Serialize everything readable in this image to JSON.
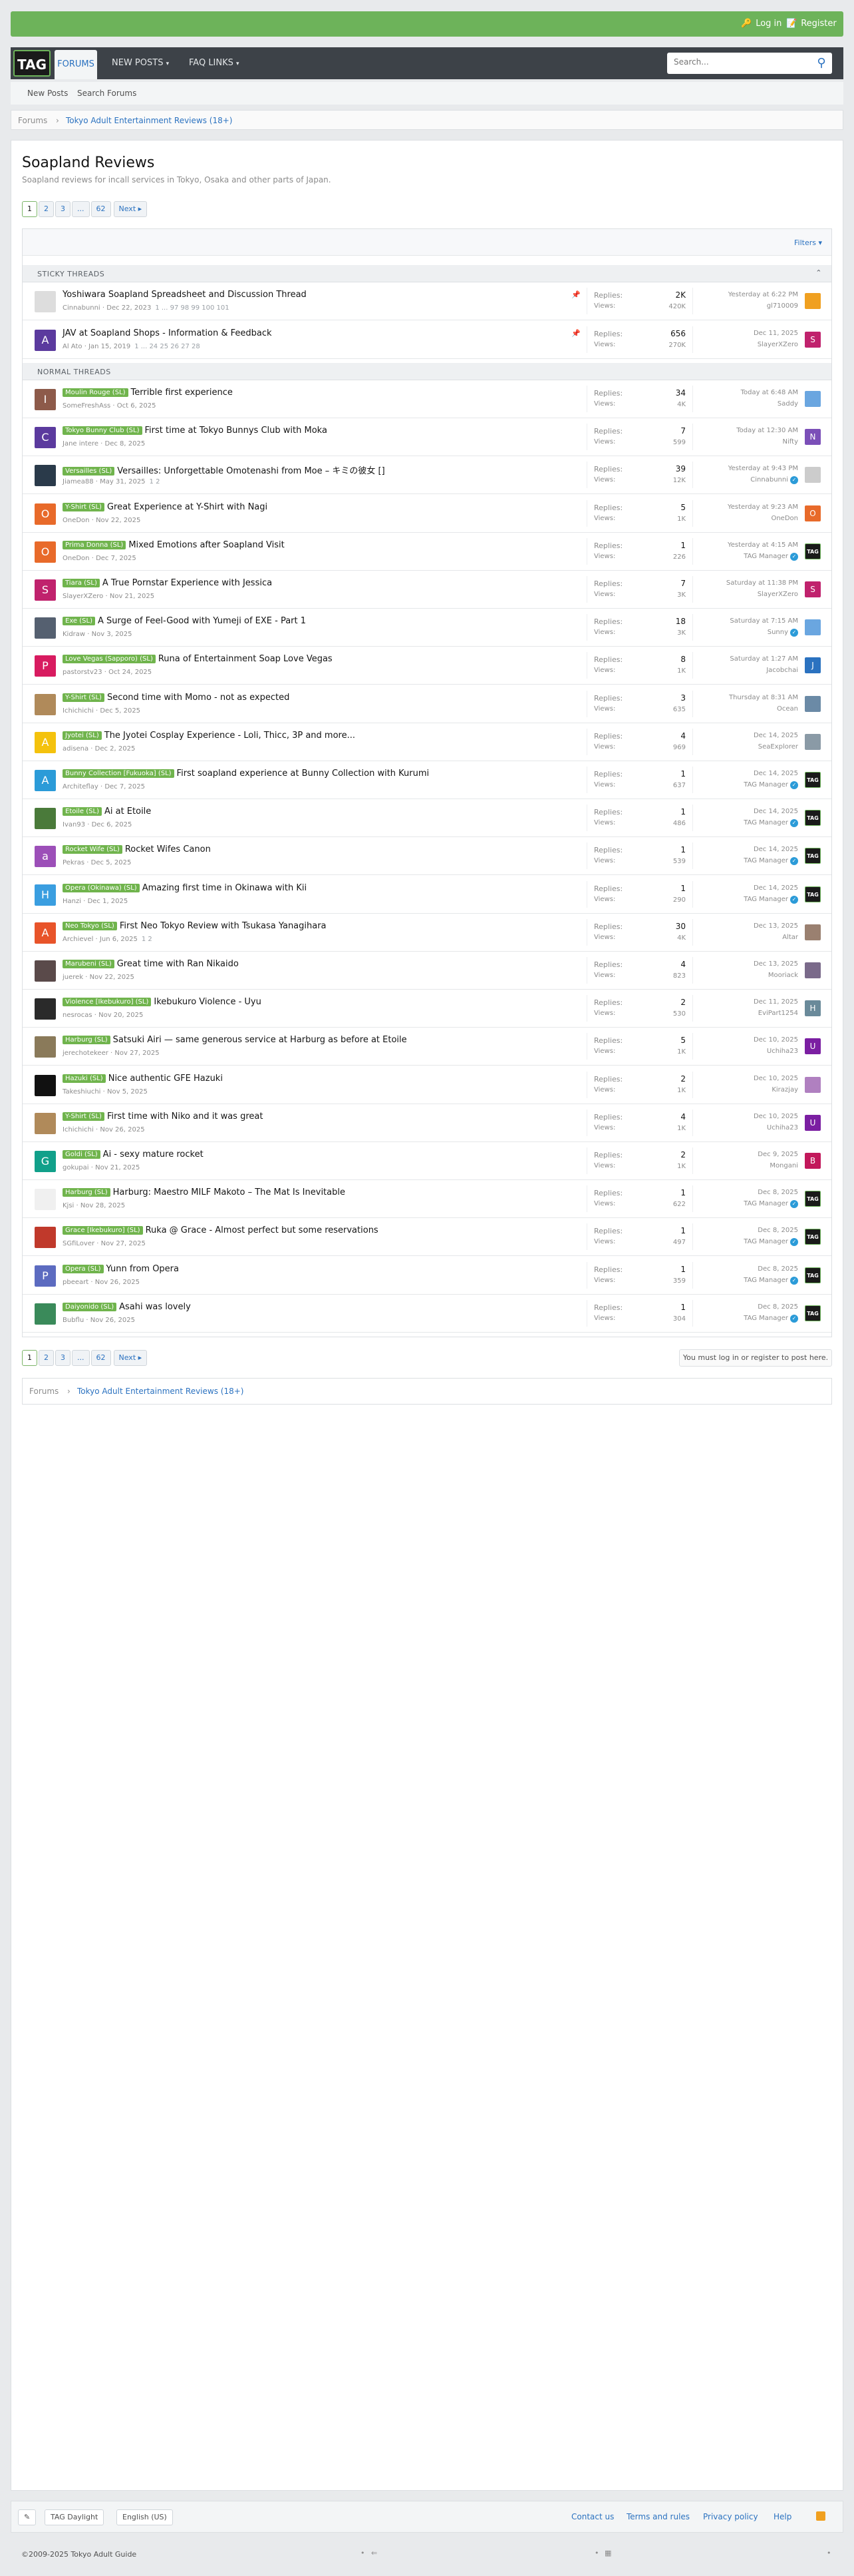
{
  "header": {
    "login_label": "Log in",
    "register_label": "Register",
    "logo_text": "TAG",
    "nav": [
      "FORUMS",
      "NEW POSTS",
      "FAQ LINKS"
    ],
    "search_placeholder": "Search...",
    "subnav": [
      "New Posts",
      "Search Forums"
    ],
    "breadcrumb": [
      "Forums",
      "Tokyo Adult Entertainment Reviews (18+)"
    ]
  },
  "forum": {
    "title": "Soapland Reviews",
    "description": "Soapland reviews for incall services in Tokyo, Osaka and other parts of Japan.",
    "pages": [
      "1",
      "2",
      "3",
      "...",
      "62",
      "Next ▸"
    ],
    "filters_label": "Filters ▾",
    "sticky_label": "STICKY THREADS",
    "normal_label": "NORMAL THREADS",
    "login_note": "You must log in or register to post here."
  },
  "sticky": [
    {
      "prefix": "",
      "title": "Yoshiwara Soapland Spreadsheet and Discussion Thread",
      "author": "Cinnabunni",
      "date": "Dec 22, 2023",
      "pages": "1 ... 97 98 99 100 101",
      "replies": "2K",
      "views": "420K",
      "last_date": "Yesterday at 6:22 PM",
      "last_user": "gl710009",
      "av": "",
      "av_color": "#dddddd",
      "sav": "",
      "sav_color": "#f0a020"
    },
    {
      "prefix": "",
      "title": "JAV at Soapland Shops - Information & Feedback",
      "author": "Al Ato",
      "date": "Jan 15, 2019",
      "pages": "1 ... 24 25 26 27 28",
      "replies": "656",
      "views": "270K",
      "last_date": "Dec 11, 2025",
      "last_user": "SlayerXZero",
      "av": "A",
      "av_color": "#5b3a9e",
      "sav": "S",
      "sav_color": "#c0226d"
    }
  ],
  "threads": [
    {
      "prefix": "Moulin Rouge (SL)",
      "title": "Terrible first experience",
      "author": "SomeFreshAss",
      "date": "Oct 6, 2025",
      "pages": "",
      "replies": "34",
      "views": "4K",
      "last_date": "Today at 6:48 AM",
      "last_user": "Saddy",
      "av": "I",
      "av_color": "#8d5a4a",
      "sav": "",
      "sav_color": "#6aa6e0"
    },
    {
      "prefix": "Tokyo Bunny Club (SL)",
      "title": "First time at Tokyo Bunnys Club with Moka",
      "author": "Jane intere",
      "date": "Dec 8, 2025",
      "pages": "",
      "replies": "7",
      "views": "599",
      "last_date": "Today at 12:30 AM",
      "last_user": "Nifty",
      "av": "C",
      "av_color": "#5b3a9e",
      "sav": "N",
      "sav_color": "#7b4fb8"
    },
    {
      "prefix": "Versailles (SL)",
      "title": "Versailles: Unforgettable Omotenashi from Moe – キミの彼女 []",
      "author": "Jiamea88",
      "date": "May 31, 2025",
      "pages": "1 2",
      "replies": "39",
      "views": "12K",
      "last_date": "Yesterday at 9:43 PM",
      "last_user": "Cinnabunni",
      "av": "",
      "av_color": "#2a3a4a",
      "sav": "",
      "sav_color": "#cccccc"
    },
    {
      "prefix": "Y-Shirt (SL)",
      "title": "Great Experience at Y-Shirt with Nagi",
      "author": "OneDon",
      "date": "Nov 22, 2025",
      "pages": "",
      "replies": "5",
      "views": "1K",
      "last_date": "Yesterday at 9:23 AM",
      "last_user": "OneDon",
      "av": "O",
      "av_color": "#e86a2a",
      "sav": "O",
      "sav_color": "#e86a2a"
    },
    {
      "prefix": "Prima Donna (SL)",
      "title": "Mixed Emotions after Soapland Visit",
      "author": "OneDon",
      "date": "Dec 7, 2025",
      "pages": "",
      "replies": "1",
      "views": "226",
      "last_date": "Yesterday at 4:15 AM",
      "last_user": "TAG Manager",
      "av": "O",
      "av_color": "#e86a2a",
      "sav": "TAG",
      "sav_color": "#1a1a1a"
    },
    {
      "prefix": "Tiara (SL)",
      "title": "A True Pornstar Experience with Jessica",
      "author": "SlayerXZero",
      "date": "Nov 21, 2025",
      "pages": "",
      "replies": "7",
      "views": "3K",
      "last_date": "Saturday at 11:38 PM",
      "last_user": "SlayerXZero",
      "av": "S",
      "av_color": "#c0226d",
      "sav": "S",
      "sav_color": "#c0226d"
    },
    {
      "prefix": "Exe (SL)",
      "title": "A Surge of Feel-Good with Yumeji of EXE - Part 1",
      "author": "Kidraw",
      "date": "Nov 3, 2025",
      "pages": "",
      "replies": "18",
      "views": "3K",
      "last_date": "Saturday at 7:15 AM",
      "last_user": "Sunny",
      "av": "",
      "av_color": "#556070",
      "sav": "",
      "sav_color": "#6aa6e0"
    },
    {
      "prefix": "Love Vegas (Sapporo) (SL)",
      "title": "Runa of Entertainment Soap Love Vegas",
      "author": "pastorstv23",
      "date": "Oct 24, 2025",
      "pages": "",
      "replies": "8",
      "views": "1K",
      "last_date": "Saturday at 1:27 AM",
      "last_user": "Jacobchai",
      "av": "P",
      "av_color": "#d81b60",
      "sav": "J",
      "sav_color": "#2b72c0"
    },
    {
      "prefix": "Y-Shirt (SL)",
      "title": "Second time with Momo - not as expected",
      "author": "Ichichichi",
      "date": "Dec 5, 2025",
      "pages": "",
      "replies": "3",
      "views": "635",
      "last_date": "Thursday at 8:31 AM",
      "last_user": "Ocean",
      "av": "",
      "av_color": "#b08a5a",
      "sav": "",
      "sav_color": "#6b8aa6"
    },
    {
      "prefix": "Jyotei (SL)",
      "title": "The Jyotei Cosplay Experience - Loli, Thicc, 3P and more...",
      "author": "adisena",
      "date": "Dec 2, 2025",
      "pages": "",
      "replies": "4",
      "views": "969",
      "last_date": "Dec 14, 2025",
      "last_user": "SeaExplorer",
      "av": "A",
      "av_color": "#f4c20d",
      "sav": "",
      "sav_color": "#8a9aa6"
    },
    {
      "prefix": "Bunny Collection [Fukuoka] (SL)",
      "title": "First soapland experience at Bunny Collection with Kurumi",
      "author": "Architeflay",
      "date": "Dec 7, 2025",
      "pages": "",
      "replies": "1",
      "views": "637",
      "last_date": "Dec 14, 2025",
      "last_user": "TAG Manager",
      "av": "A",
      "av_color": "#2b9bd8",
      "sav": "TAG",
      "sav_color": "#1a1a1a"
    },
    {
      "prefix": "Etoile (SL)",
      "title": "Ai at Etoile",
      "author": "Ivan93",
      "date": "Dec 6, 2025",
      "pages": "",
      "replies": "1",
      "views": "486",
      "last_date": "Dec 14, 2025",
      "last_user": "TAG Manager",
      "av": "",
      "av_color": "#4a7a3a",
      "sav": "TAG",
      "sav_color": "#1a1a1a"
    },
    {
      "prefix": "Rocket Wife (SL)",
      "title": "Rocket Wifes Canon",
      "author": "Pekras",
      "date": "Dec 5, 2025",
      "pages": "",
      "replies": "1",
      "views": "539",
      "last_date": "Dec 14, 2025",
      "last_user": "TAG Manager",
      "av": "a",
      "av_color": "#9c4fb8",
      "sav": "TAG",
      "sav_color": "#1a1a1a"
    },
    {
      "prefix": "Opera (Okinawa) (SL)",
      "title": "Amazing first time in Okinawa with Kii",
      "author": "Hanzi",
      "date": "Dec 1, 2025",
      "pages": "",
      "replies": "1",
      "views": "290",
      "last_date": "Dec 14, 2025",
      "last_user": "TAG Manager",
      "av": "H",
      "av_color": "#3a9ee0",
      "sav": "TAG",
      "sav_color": "#1a1a1a"
    },
    {
      "prefix": "Neo Tokyo (SL)",
      "title": "First Neo Tokyo Review with Tsukasa Yanagihara",
      "author": "Archievel",
      "date": "Jun 6, 2025",
      "pages": "1 2",
      "replies": "30",
      "views": "4K",
      "last_date": "Dec 13, 2025",
      "last_user": "Altar",
      "av": "A",
      "av_color": "#e8542a",
      "sav": "",
      "sav_color": "#9a8070"
    },
    {
      "prefix": "Marubeni (SL)",
      "title": "Great time with Ran Nikaido",
      "author": "juerek",
      "date": "Nov 22, 2025",
      "pages": "",
      "replies": "4",
      "views": "823",
      "last_date": "Dec 13, 2025",
      "last_user": "Mooriack",
      "av": "",
      "av_color": "#5a4a4a",
      "sav": "",
      "sav_color": "#7a6a8a"
    },
    {
      "prefix": "Violence [Ikebukuro] (SL)",
      "title": "Ikebukuro Violence - Uyu",
      "author": "nesrocas",
      "date": "Nov 20, 2025",
      "pages": "",
      "replies": "2",
      "views": "530",
      "last_date": "Dec 11, 2025",
      "last_user": "EviPart1254",
      "av": "",
      "av_color": "#2a2a2a",
      "sav": "H",
      "sav_color": "#6a8a9a"
    },
    {
      "prefix": "Harburg (SL)",
      "title": "Satsuki Airi — same generous service at Harburg as before at Etoile",
      "author": "jerechotekeer",
      "date": "Nov 27, 2025",
      "pages": "",
      "replies": "5",
      "views": "1K",
      "last_date": "Dec 10, 2025",
      "last_user": "Uchiha23",
      "av": "",
      "av_color": "#8a7a5a",
      "sav": "U",
      "sav_color": "#7b1fa2"
    },
    {
      "prefix": "Hazuki (SL)",
      "title": "Nice authentic GFE Hazuki",
      "author": "Takeshiuchi",
      "date": "Nov 5, 2025",
      "pages": "",
      "replies": "2",
      "views": "1K",
      "last_date": "Dec 10, 2025",
      "last_user": "Kirazjay",
      "av": "",
      "av_color": "#111111",
      "sav": "",
      "sav_color": "#b080c0"
    },
    {
      "prefix": "Y-Shirt (SL)",
      "title": "First time with Niko and it was great",
      "author": "Ichichichi",
      "date": "Nov 26, 2025",
      "pages": "",
      "replies": "4",
      "views": "1K",
      "last_date": "Dec 10, 2025",
      "last_user": "Uchiha23",
      "av": "",
      "av_color": "#b08a5a",
      "sav": "U",
      "sav_color": "#7b1fa2"
    },
    {
      "prefix": "Goldi (SL)",
      "title": "Ai - sexy mature rocket",
      "author": "gokupai",
      "date": "Nov 21, 2025",
      "pages": "",
      "replies": "2",
      "views": "1K",
      "last_date": "Dec 9, 2025",
      "last_user": "Mongani",
      "av": "G",
      "av_color": "#11a08a",
      "sav": "B",
      "sav_color": "#c2185b"
    },
    {
      "prefix": "Harburg (SL)",
      "title": "Harburg: Maestro MILF Makoto – The Mat Is Inevitable",
      "author": "Kjsi",
      "date": "Nov 28, 2025",
      "pages": "",
      "replies": "1",
      "views": "622",
      "last_date": "Dec 8, 2025",
      "last_user": "TAG Manager",
      "av": "",
      "av_color": "#f0f0f0",
      "sav": "TAG",
      "sav_color": "#1a1a1a"
    },
    {
      "prefix": "Grace [Ikebukuro] (SL)",
      "title": "Ruka @ Grace - Almost perfect but some reservations",
      "author": "SGfiLover",
      "date": "Nov 27, 2025",
      "pages": "",
      "replies": "1",
      "views": "497",
      "last_date": "Dec 8, 2025",
      "last_user": "TAG Manager",
      "av": "",
      "av_color": "#c0392b",
      "sav": "TAG",
      "sav_color": "#1a1a1a"
    },
    {
      "prefix": "Opera (SL)",
      "title": "Yunn from Opera",
      "author": "pbeeart",
      "date": "Nov 26, 2025",
      "pages": "",
      "replies": "1",
      "views": "359",
      "last_date": "Dec 8, 2025",
      "last_user": "TAG Manager",
      "av": "P",
      "av_color": "#5c6bc0",
      "sav": "TAG",
      "sav_color": "#1a1a1a"
    },
    {
      "prefix": "Daiyonido (SL)",
      "title": "Asahi was lovely",
      "author": "Bubflu",
      "date": "Nov 26, 2025",
      "pages": "",
      "replies": "1",
      "views": "304",
      "last_date": "Dec 8, 2025",
      "last_user": "TAG Manager",
      "av": "",
      "av_color": "#3a8a5a",
      "sav": "TAG",
      "sav_color": "#1a1a1a"
    }
  ],
  "labels": {
    "replies": "Replies:",
    "views": "Views:"
  },
  "footer": {
    "style_label": "TAG Daylight",
    "lang_label": "English (US)",
    "links": [
      "Contact us",
      "Terms and rules",
      "Privacy policy",
      "Help"
    ],
    "copyright": "©2009-2025 Tokyo Adult Guide"
  },
  "colors": {
    "accent": "#6db35a",
    "nav": "#3d4248",
    "link": "#2b72c0"
  }
}
